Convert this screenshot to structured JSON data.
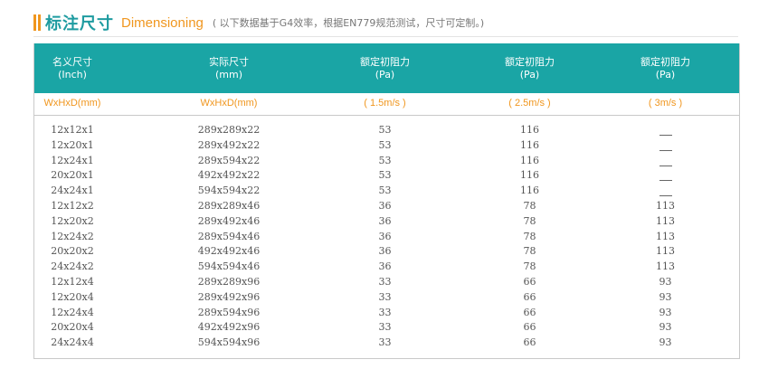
{
  "title": {
    "main": "标注尺寸",
    "english": "Dimensioning",
    "note": "( 以下数据基于G4效率，根据EN779规范测试，尺寸可定制。)"
  },
  "headers": [
    {
      "line1": "名义尺寸",
      "line2": "(Inch)"
    },
    {
      "line1": "实际尺寸",
      "line2": "(mm)"
    },
    {
      "line1": "额定初阻力",
      "line2": "(Pa)"
    },
    {
      "line1": "额定初阻力",
      "line2": "(Pa)"
    },
    {
      "line1": "额定初阻力",
      "line2": "(Pa)"
    }
  ],
  "units": [
    "WxHxD(mm)",
    "WxHxD(mm)",
    "( 1.5m/s )",
    "( 2.5m/s )",
    "( 3m/s )"
  ],
  "rows": [
    [
      "12x12x1",
      "289x289x22",
      "53",
      "116",
      "—"
    ],
    [
      "12x20x1",
      "289x492x22",
      "53",
      "116",
      "—"
    ],
    [
      "12x24x1",
      "289x594x22",
      "53",
      "116",
      "—"
    ],
    [
      "20x20x1",
      "492x492x22",
      "53",
      "116",
      "—"
    ],
    [
      "24x24x1",
      "594x594x22",
      "53",
      "116",
      "—"
    ],
    [
      "12x12x2",
      "289x289x46",
      "36",
      "78",
      "113"
    ],
    [
      "12x20x2",
      "289x492x46",
      "36",
      "78",
      "113"
    ],
    [
      "12x24x2",
      "289x594x46",
      "36",
      "78",
      "113"
    ],
    [
      "20x20x2",
      "492x492x46",
      "36",
      "78",
      "113"
    ],
    [
      "24x24x2",
      "594x594x46",
      "36",
      "78",
      "113"
    ],
    [
      "12x12x4",
      "289x289x96",
      "33",
      "66",
      "93"
    ],
    [
      "12x20x4",
      "289x492x96",
      "33",
      "66",
      "93"
    ],
    [
      "12x24x4",
      "289x594x96",
      "33",
      "66",
      "93"
    ],
    [
      "20x20x4",
      "492x492x96",
      "33",
      "66",
      "93"
    ],
    [
      "24x24x4",
      "594x594x96",
      "33",
      "66",
      "93"
    ]
  ],
  "colors": {
    "accent": "#1aa5a5",
    "orange": "#f0961e"
  }
}
